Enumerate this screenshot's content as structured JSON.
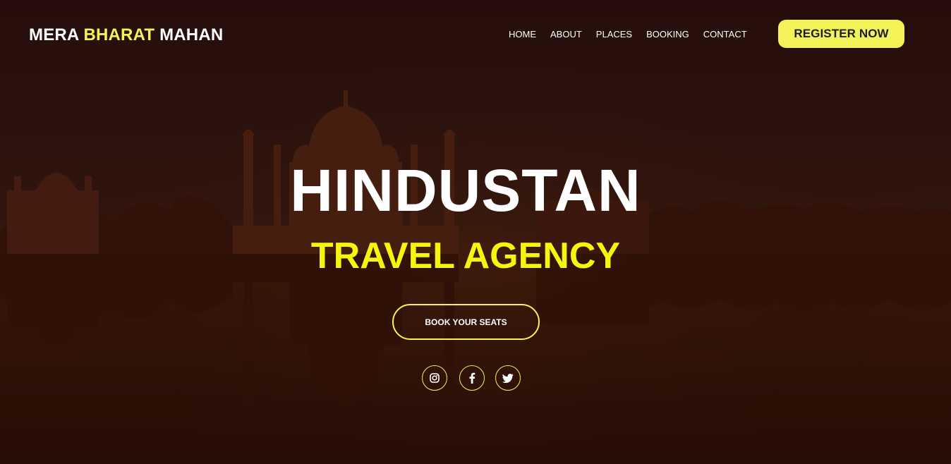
{
  "nav": {
    "brand_part1": "MERA ",
    "brand_highlight": "BHARAT",
    "brand_part2": " MAHAN",
    "links": [
      "HOME",
      "ABOUT",
      "PLACES",
      "BOOKING",
      "CONTACT"
    ],
    "register_label": "REGISTER NOW"
  },
  "hero": {
    "title": "HINDUSTAN",
    "subtitle": "TRAVEL AGENCY",
    "cta_label": "BOOK YOUR SEATS",
    "background": "taj-mahal-sunset-reflection-photo"
  },
  "social": [
    {
      "name": "instagram-icon"
    },
    {
      "name": "facebook-icon"
    },
    {
      "name": "twitter-icon"
    }
  ],
  "colors": {
    "accent": "#f3f357",
    "subtitle": "#f5f50e",
    "text": "#ffffff",
    "overlay": "#3a1a0c"
  }
}
